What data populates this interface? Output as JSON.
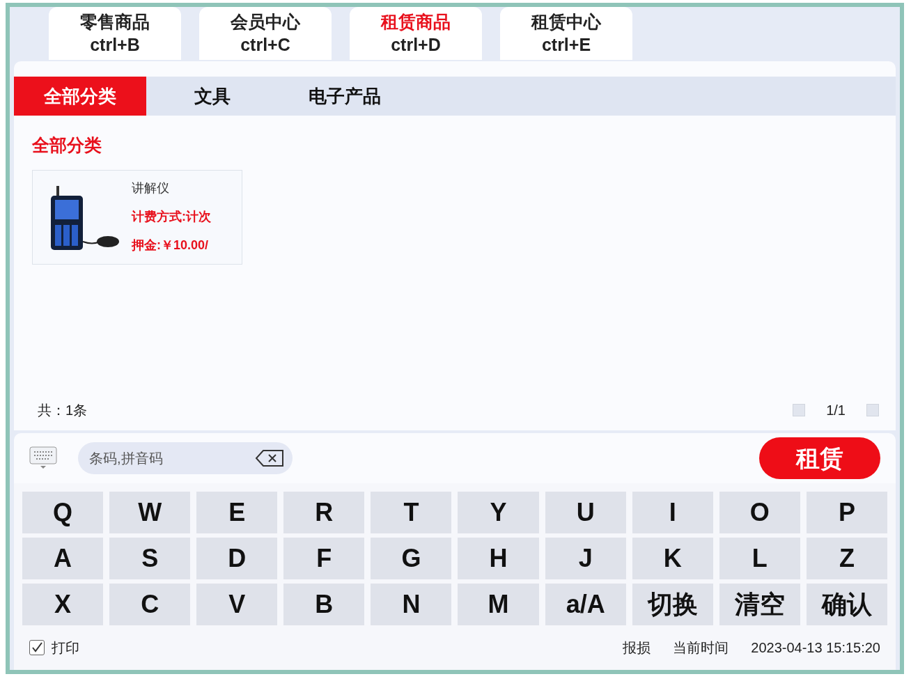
{
  "top_tabs": [
    {
      "label": "零售商品",
      "shortcut": "ctrl+B",
      "selected": false
    },
    {
      "label": "会员中心",
      "shortcut": "ctrl+C",
      "selected": false
    },
    {
      "label": "租赁商品",
      "shortcut": "ctrl+D",
      "selected": true
    },
    {
      "label": "租赁中心",
      "shortcut": "ctrl+E",
      "selected": false
    }
  ],
  "categories": [
    {
      "label": "全部分类",
      "selected": true
    },
    {
      "label": "文具",
      "selected": false
    },
    {
      "label": "电子产品",
      "selected": false
    }
  ],
  "section_title": "全部分类",
  "products": [
    {
      "name": "讲解仪",
      "billing": "计费方式:计次",
      "deposit": "押金:￥10.00/"
    }
  ],
  "total": "共：1条",
  "page": "1/1",
  "search": {
    "placeholder": "条码,拼音码"
  },
  "rent_button": "租赁",
  "keys": [
    [
      "Q",
      "W",
      "E",
      "R",
      "T",
      "Y",
      "U",
      "I",
      "O",
      "P"
    ],
    [
      "A",
      "S",
      "D",
      "F",
      "G",
      "H",
      "J",
      "K",
      "L",
      "Z"
    ],
    [
      "X",
      "C",
      "V",
      "B",
      "N",
      "M",
      "a/A",
      "切换",
      "清空",
      "确认"
    ]
  ],
  "print": {
    "label": "打印",
    "checked": true
  },
  "status": {
    "damage": "报损",
    "time_label": "当前时间",
    "time": "2023-04-13 15:15:20"
  }
}
